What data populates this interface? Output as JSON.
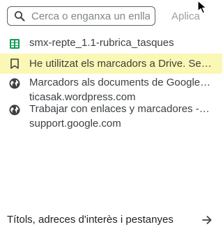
{
  "search": {
    "placeholder": "Cerca o enganxa un enllaç",
    "value": "",
    "apply_label": "Aplica"
  },
  "items": [
    {
      "icon": "spreadsheet-icon",
      "title": "smx-repte_1.1-rubrica_tasques",
      "subtitle": ""
    },
    {
      "icon": "bookmark-icon",
      "title": "He utilitzat els marcadors a Drive. Serveix per...",
      "subtitle": ""
    },
    {
      "icon": "globe-icon",
      "title": "Marcadors als documents de Google Docs",
      "subtitle": "ticasak.wordpress.com"
    },
    {
      "icon": "globe-icon",
      "title": "Trabajar con enlaces y marcadores - Ordenador",
      "subtitle": "support.google.com"
    }
  ],
  "footer": {
    "label": "Títols, adreces d'interès i pestanyes",
    "icon": "arrow-right-icon"
  },
  "colors": {
    "highlight": "#fbf7b4",
    "sheets_green": "#0f9d58"
  }
}
